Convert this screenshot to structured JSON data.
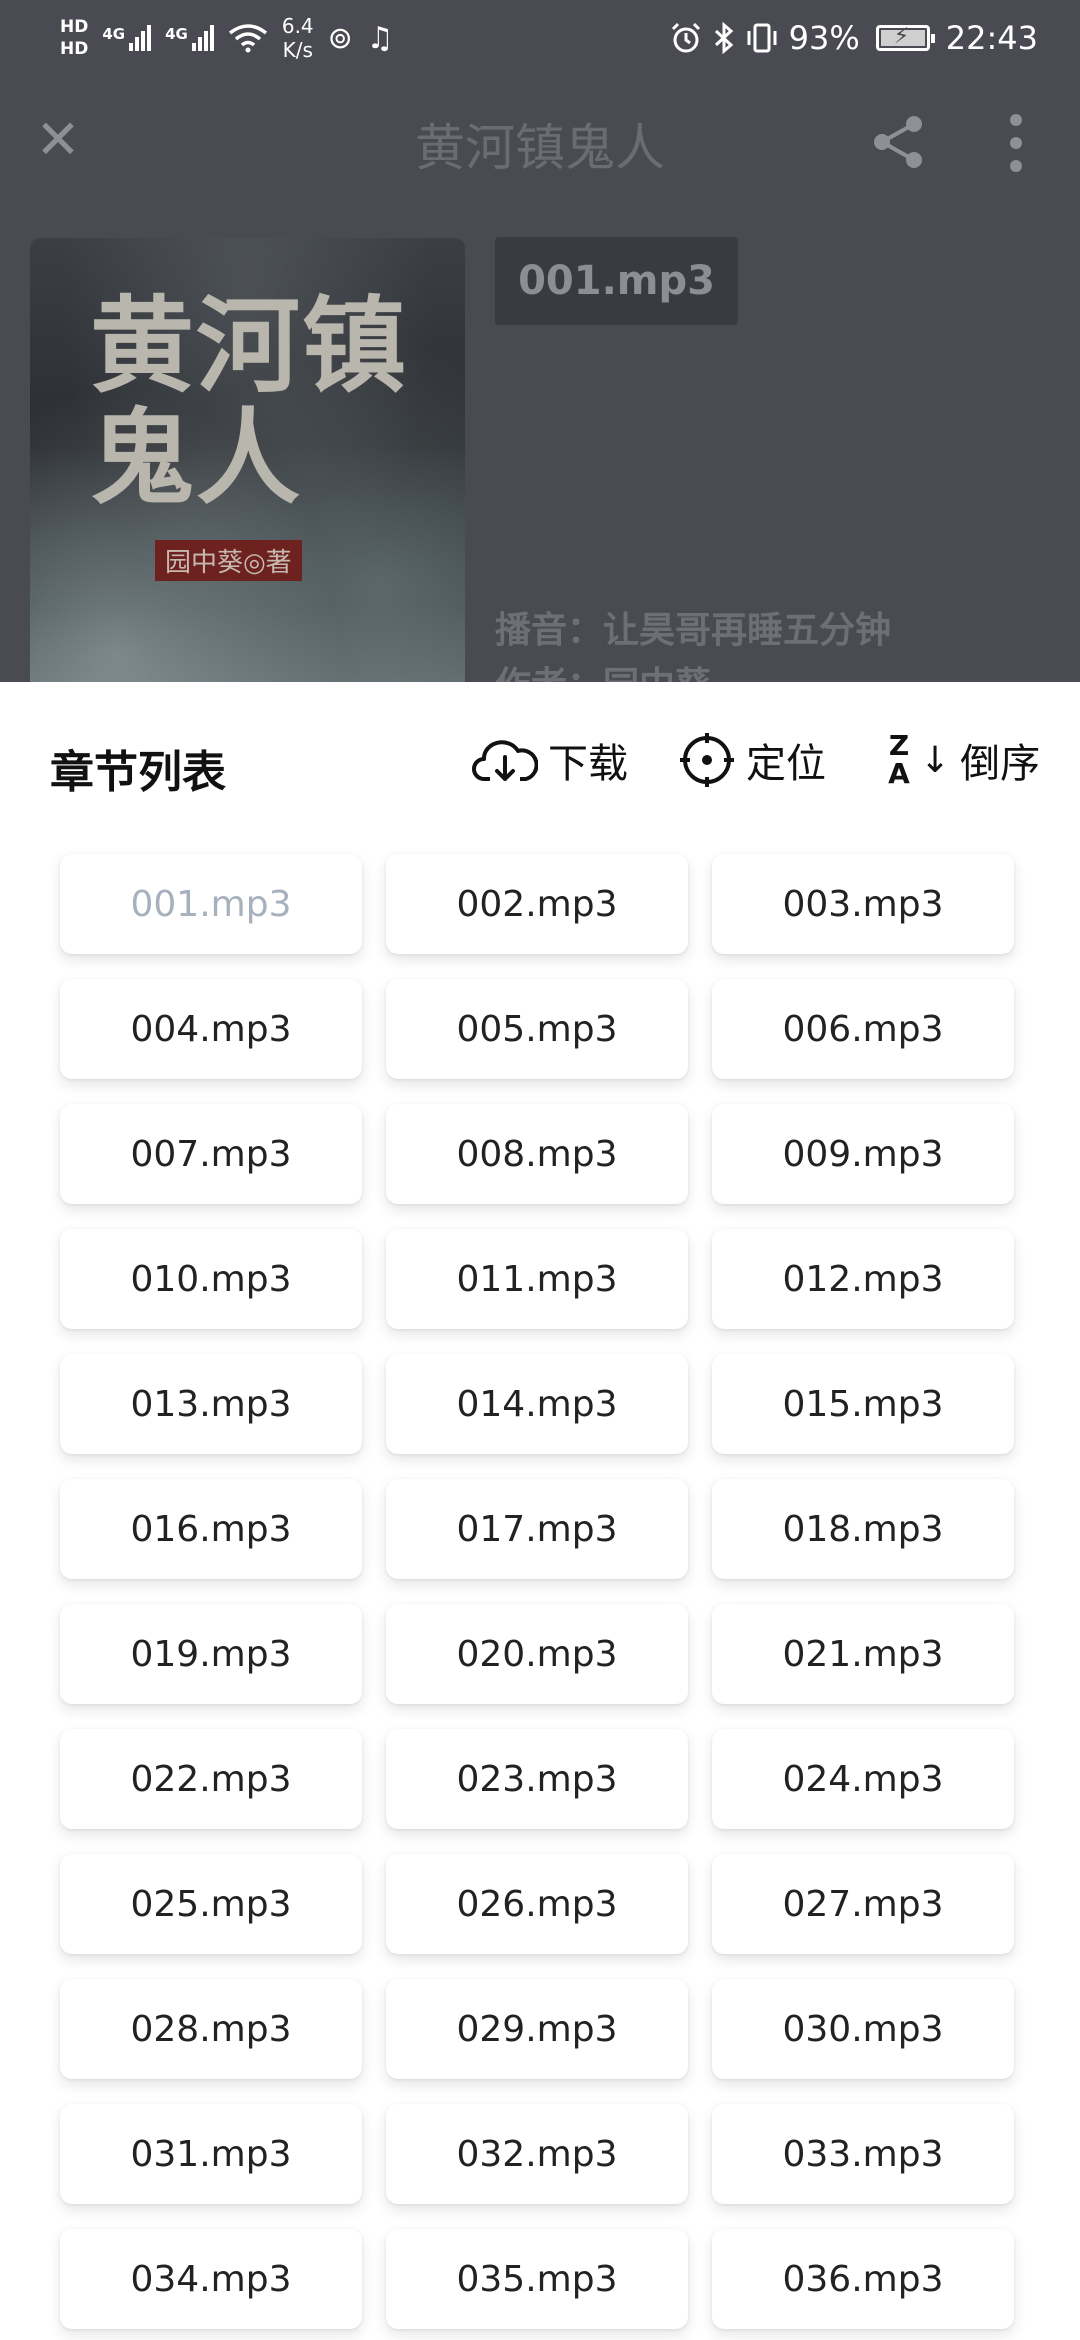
{
  "status_bar": {
    "hd1": "HD",
    "hd2": "HD",
    "net1": "4G",
    "net2": "4G",
    "speed_value": "6.4",
    "speed_unit": "K/s",
    "battery": "93%",
    "time": "22:43",
    "battery_level": 0.93
  },
  "header": {
    "title": "黄河镇鬼人",
    "close_icon": "close-icon",
    "share_icon": "share-icon",
    "more_icon": "more-vertical-icon"
  },
  "book": {
    "cover_title": "黄河镇鬼人",
    "cover_author": "园中葵◎著",
    "current_file": "001.mp3",
    "narrator": "播音：让昊哥再睡五分钟",
    "author": "作者：园中葵"
  },
  "sheet": {
    "title": "章节列表",
    "download_label": "下载",
    "locate_label": "定位",
    "sort_label": "倒序",
    "sort_z": "Z",
    "sort_a": "A"
  },
  "chapters": [
    "001.mp3",
    "002.mp3",
    "003.mp3",
    "004.mp3",
    "005.mp3",
    "006.mp3",
    "007.mp3",
    "008.mp3",
    "009.mp3",
    "010.mp3",
    "011.mp3",
    "012.mp3",
    "013.mp3",
    "014.mp3",
    "015.mp3",
    "016.mp3",
    "017.mp3",
    "018.mp3",
    "019.mp3",
    "020.mp3",
    "021.mp3",
    "022.mp3",
    "023.mp3",
    "024.mp3",
    "025.mp3",
    "026.mp3",
    "027.mp3",
    "028.mp3",
    "029.mp3",
    "030.mp3",
    "031.mp3",
    "032.mp3",
    "033.mp3",
    "034.mp3",
    "035.mp3",
    "036.mp3"
  ],
  "active_chapter_index": 0,
  "colors": {
    "overlay": "#4a4b52",
    "active_chapter_text": "#a7b0bd",
    "chapter_text": "#222222"
  }
}
